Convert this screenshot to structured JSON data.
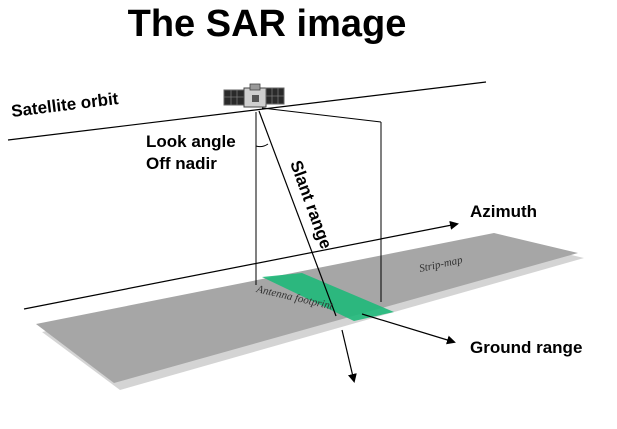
{
  "title": "The SAR image",
  "labels": {
    "satellite_orbit": "Satellite orbit",
    "look_angle": "Look angle",
    "off_nadir": "Off nadir",
    "slant_range": "Slant range",
    "azimuth": "Azimuth",
    "ground_range": "Ground range",
    "strip_map": "Strip-map",
    "antenna_footprint": "Antenna footprint"
  },
  "colors": {
    "ground_strip": "#a6a6a6",
    "ground_shadow": "#d4d4d4",
    "footprint": "#1fb97a",
    "lines": "#000000"
  },
  "icons": {
    "satellite": "satellite-icon"
  }
}
